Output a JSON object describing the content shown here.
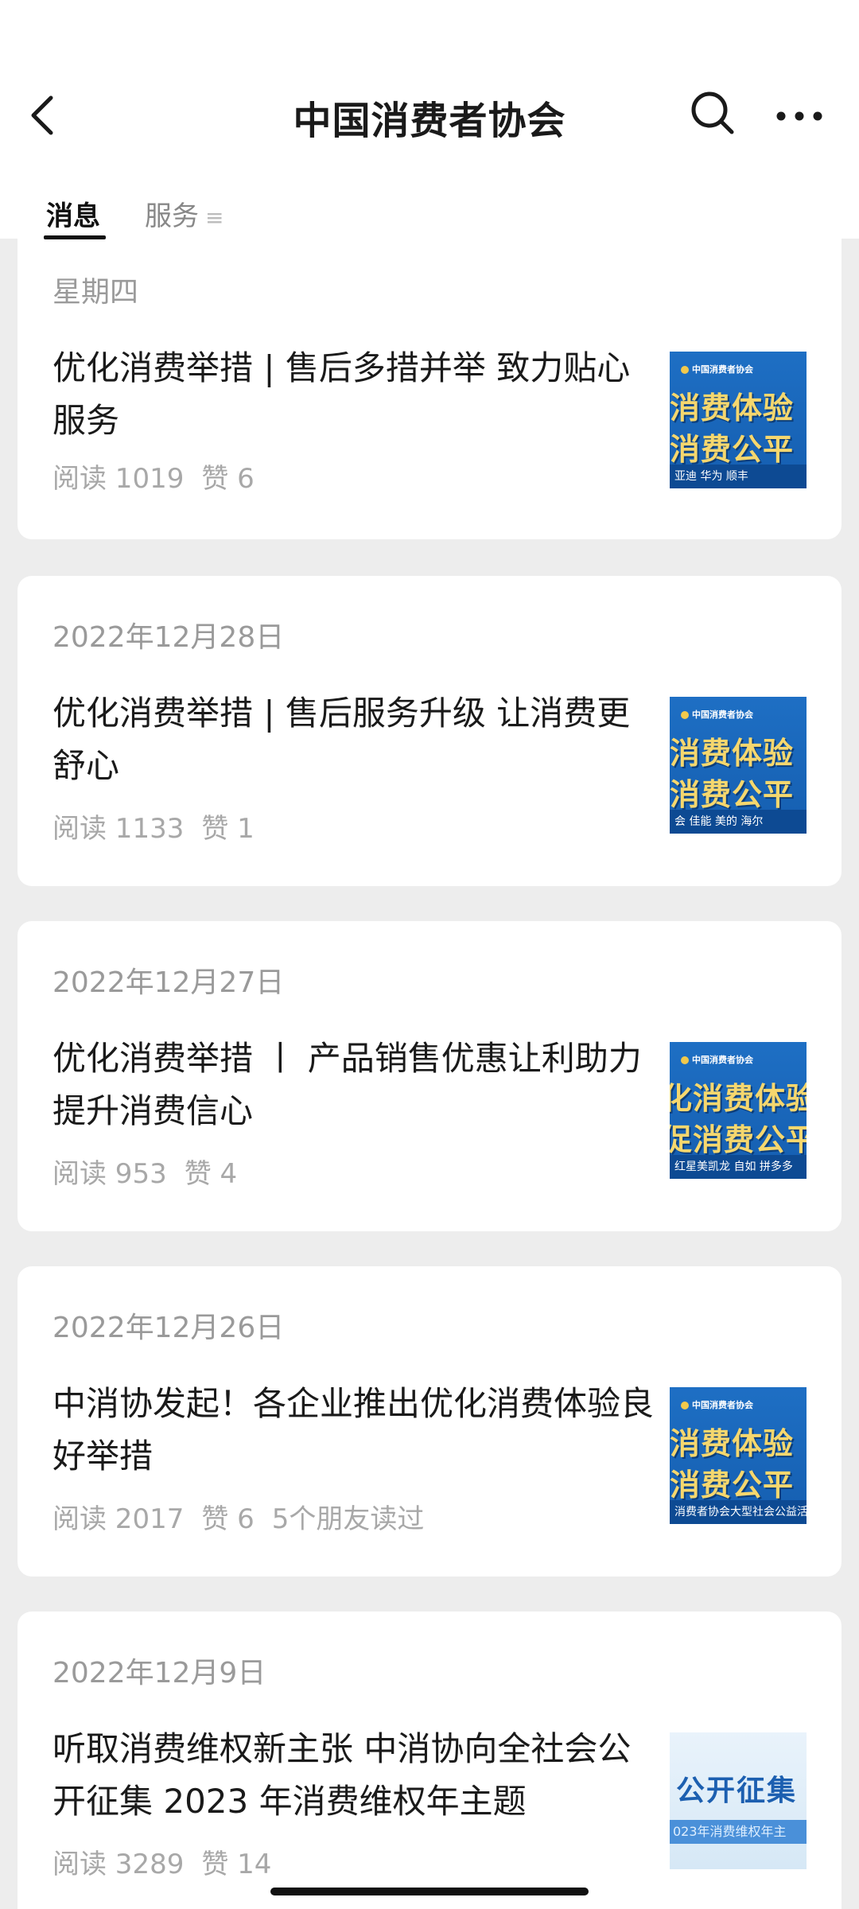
{
  "header": {
    "title": "中国消费者协会",
    "back_icon": "chevron-left-icon",
    "search_icon": "search-icon",
    "more_icon": "more-horizontal-icon"
  },
  "tabs": [
    {
      "label": "消息",
      "active": true
    },
    {
      "label": "服务",
      "icon": "≡"
    }
  ],
  "articles": [
    {
      "date": "星期四",
      "title": "优化消费举措 | 售后多措并举 致力贴心服务",
      "reads": "阅读 1019",
      "likes": "赞 6",
      "friends": "",
      "thumb": {
        "org": "中国消费者协会",
        "line1": "消费体验",
        "line2": "消费公平",
        "footer": "亚迪  华为  顺丰"
      }
    },
    {
      "date": "2022年12月28日",
      "title": "优化消费举措 | 售后服务升级 让消费更舒心",
      "reads": "阅读 1133",
      "likes": "赞 1",
      "friends": "",
      "thumb": {
        "org": "中国消费者协会",
        "line1": "消费体验",
        "line2": "消费公平",
        "footer": "会  佳能  美的  海尔"
      }
    },
    {
      "date": "2022年12月27日",
      "title": "优化消费举措 丨 产品销售优惠让利助力提升消费信心",
      "reads": "阅读 953",
      "likes": "赞 4",
      "friends": "",
      "thumb": {
        "org": "中国消费者协会",
        "line1": "化消费体验",
        "line2": "促消费公平",
        "footer": "红星美凯龙  自如  拼多多"
      }
    },
    {
      "date": "2022年12月26日",
      "title": "中消协发起！各企业推出优化消费体验良好举措",
      "reads": "阅读 2017",
      "likes": "赞 6",
      "friends": "5个朋友读过",
      "thumb": {
        "org": "中国消费者协会",
        "line1": "消费体验",
        "line2": "消费公平",
        "footer": "消费者协会大型社会公益活动"
      }
    },
    {
      "date": "2022年12月9日",
      "title": "听取消费维权新主张 中消协向全社会公开征集 2023 年消费维权年主题",
      "reads": "阅读 3289",
      "likes": "赞 14",
      "friends": "",
      "thumb": {
        "big": "公开征集",
        "sub": "023年消费维权年主"
      }
    }
  ]
}
